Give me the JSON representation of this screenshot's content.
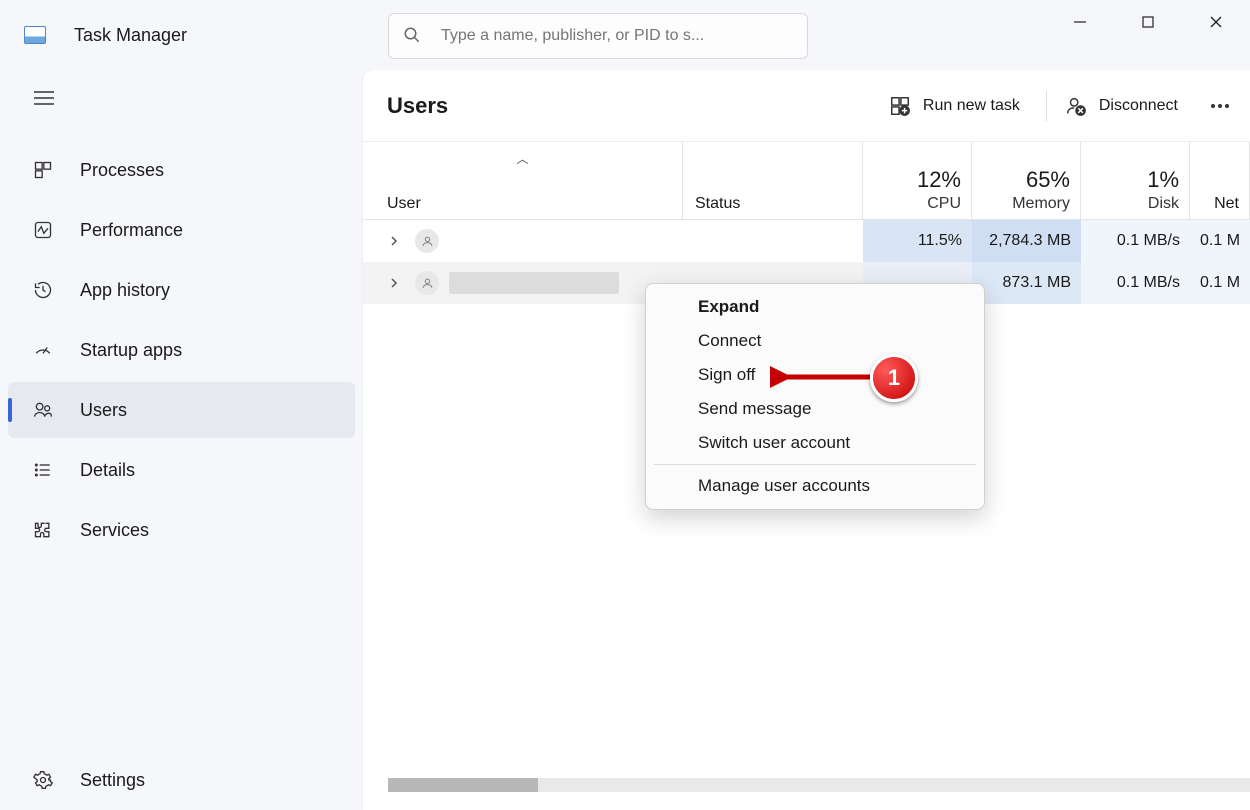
{
  "app": {
    "title": "Task Manager"
  },
  "search": {
    "placeholder": "Type a name, publisher, or PID to s..."
  },
  "sidebar": {
    "items": [
      {
        "label": "Processes"
      },
      {
        "label": "Performance"
      },
      {
        "label": "App history"
      },
      {
        "label": "Startup apps"
      },
      {
        "label": "Users"
      },
      {
        "label": "Details"
      },
      {
        "label": "Services"
      }
    ],
    "settings_label": "Settings"
  },
  "header": {
    "page_title": "Users",
    "run_new_task": "Run new task",
    "disconnect": "Disconnect"
  },
  "columns": {
    "user": "User",
    "status": "Status",
    "cpu": {
      "value": "12%",
      "label": "CPU"
    },
    "memory": {
      "value": "65%",
      "label": "Memory"
    },
    "disk": {
      "value": "1%",
      "label": "Disk"
    },
    "net": {
      "label": "Net"
    }
  },
  "rows": [
    {
      "cpu": "11.5%",
      "memory": "2,784.3 MB",
      "disk": "0.1 MB/s",
      "net": "0.1 M"
    },
    {
      "cpu": "",
      "memory": "873.1 MB",
      "disk": "0.1 MB/s",
      "net": "0.1 M"
    }
  ],
  "context_menu": {
    "expand": "Expand",
    "connect": "Connect",
    "sign_off": "Sign off",
    "send_message": "Send message",
    "switch_user": "Switch user account",
    "manage": "Manage user accounts"
  },
  "annotation": {
    "number": "1"
  }
}
